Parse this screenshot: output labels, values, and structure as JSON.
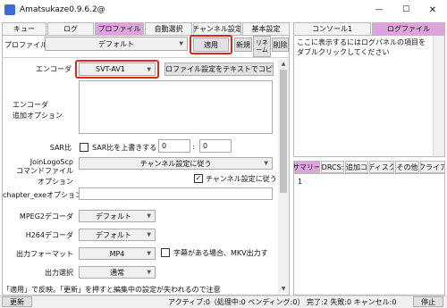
{
  "window": {
    "title": "Amatsukaze0.9.6.2@",
    "minimize": "—",
    "maximize": "☐",
    "close": "✕"
  },
  "tabs": [
    "キュー",
    "ログ",
    "プロファイル",
    "自動選択",
    "チャンネル設定",
    "基本設定"
  ],
  "right_tabs": [
    "コンソール1",
    "ログファイル"
  ],
  "profile_bar": {
    "label": "プロファイル",
    "selected": "デフォルト",
    "apply_button": "適用",
    "new_button": "新規",
    "rename_button": "リネーム",
    "delete_button": "削除"
  },
  "form": {
    "encoder_label": "エンコーダ",
    "encoder_value": "SVT-AV1",
    "copy_button": "プロファイル設定をテキストでコピー",
    "extra_options_label": "エンコーダ\n追加オプション",
    "sar_label": "SAR比",
    "sar_overwrite": "SAR比を上書きする",
    "sar_num": "0",
    "sar_sep": ":",
    "sar_den": "0",
    "jls_cmd_label": "JoinLogoScp\nコマンドファイル",
    "jls_cmd_value": "チャンネル設定に従う",
    "jls_opt_label": "オプション",
    "jls_opt_check": "チャンネル設定に従う",
    "chapter_exe_label": "chapter_exeオプション",
    "mpeg2_label": "MPEG2デコーダ",
    "mpeg2_value": "デフォルト",
    "h264_label": "H264デコーダ",
    "h264_value": "デフォルト",
    "output_format_label": "出力フォーマット",
    "output_format_value": "MP4",
    "subtitle_mkv": "字幕がある場合、MKV出力す",
    "output_select_label": "出力選択",
    "output_select_value": "通常"
  },
  "log_panel": {
    "placeholder": "ここに表示するにはログパネルの項目をダブルクリックしてください"
  },
  "side_tabs": [
    "サマリー",
    "DRCS:",
    "追加コ",
    "ディスク",
    "その他",
    "クライア"
  ],
  "summary_line": "1",
  "hint": "「適用」で反映。「更新」を押すと編集中の設定が失われるので注意",
  "status": {
    "refresh_button": "更新",
    "text": "アクティブ:0（処理中:0 ペンディング:0） 完了:2 失敗:0 キャンセル:0",
    "stop_button": "停止"
  },
  "colors": {
    "active_tab": "#dfa4df",
    "highlight": "#e0261b"
  }
}
